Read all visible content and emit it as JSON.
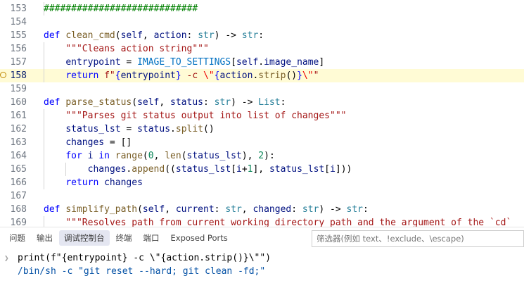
{
  "editor": {
    "lines": [
      {
        "num": "153",
        "tokens": [
          {
            "t": "############################",
            "c": "cmt"
          }
        ],
        "guides": 1
      },
      {
        "num": "154",
        "tokens": [],
        "guides": 0
      },
      {
        "num": "155",
        "tokens": [
          {
            "t": "def ",
            "c": "kw"
          },
          {
            "t": "clean_cmd",
            "c": "fn"
          },
          {
            "t": "(",
            "c": "def"
          },
          {
            "t": "self",
            "c": "var"
          },
          {
            "t": ", ",
            "c": "def"
          },
          {
            "t": "action",
            "c": "var"
          },
          {
            "t": ": ",
            "c": "def"
          },
          {
            "t": "str",
            "c": "ty"
          },
          {
            "t": ") -> ",
            "c": "def"
          },
          {
            "t": "str",
            "c": "ty"
          },
          {
            "t": ":",
            "c": "def"
          }
        ],
        "guides": 0
      },
      {
        "num": "156",
        "tokens": [
          {
            "t": "    \"\"\"Cleans action string\"\"\"",
            "c": "str"
          }
        ],
        "guides": 1
      },
      {
        "num": "157",
        "tokens": [
          {
            "t": "    ",
            "c": "def"
          },
          {
            "t": "entrypoint",
            "c": "var"
          },
          {
            "t": " = ",
            "c": "def"
          },
          {
            "t": "IMAGE_TO_SETTINGS",
            "c": "const"
          },
          {
            "t": "[",
            "c": "def"
          },
          {
            "t": "self",
            "c": "var"
          },
          {
            "t": ".",
            "c": "def"
          },
          {
            "t": "image_name",
            "c": "var"
          },
          {
            "t": "]",
            "c": "def"
          }
        ],
        "guides": 1
      },
      {
        "num": "158",
        "tokens": [
          {
            "t": "    ",
            "c": "def"
          },
          {
            "t": "return ",
            "c": "kw"
          },
          {
            "t": "f\"",
            "c": "str"
          },
          {
            "t": "{",
            "c": "kw"
          },
          {
            "t": "entrypoint",
            "c": "var"
          },
          {
            "t": "}",
            "c": "kw"
          },
          {
            "t": " -c ",
            "c": "str"
          },
          {
            "t": "\\\"",
            "c": "esc"
          },
          {
            "t": "{",
            "c": "kw"
          },
          {
            "t": "action",
            "c": "var"
          },
          {
            "t": ".",
            "c": "def"
          },
          {
            "t": "strip",
            "c": "fn"
          },
          {
            "t": "()",
            "c": "def"
          },
          {
            "t": "}",
            "c": "kw"
          },
          {
            "t": "\\\"",
            "c": "esc"
          },
          {
            "t": "\"",
            "c": "str"
          }
        ],
        "guides": 1,
        "current": true,
        "breakpoint": true
      },
      {
        "num": "159",
        "tokens": [],
        "guides": 0
      },
      {
        "num": "160",
        "tokens": [
          {
            "t": "def ",
            "c": "kw"
          },
          {
            "t": "parse_status",
            "c": "fn"
          },
          {
            "t": "(",
            "c": "def"
          },
          {
            "t": "self",
            "c": "var"
          },
          {
            "t": ", ",
            "c": "def"
          },
          {
            "t": "status",
            "c": "var"
          },
          {
            "t": ": ",
            "c": "def"
          },
          {
            "t": "str",
            "c": "ty"
          },
          {
            "t": ") -> ",
            "c": "def"
          },
          {
            "t": "List",
            "c": "ty"
          },
          {
            "t": ":",
            "c": "def"
          }
        ],
        "guides": 0
      },
      {
        "num": "161",
        "tokens": [
          {
            "t": "    \"\"\"Parses git status output into list of changes\"\"\"",
            "c": "str"
          }
        ],
        "guides": 1
      },
      {
        "num": "162",
        "tokens": [
          {
            "t": "    ",
            "c": "def"
          },
          {
            "t": "status_lst",
            "c": "var"
          },
          {
            "t": " = ",
            "c": "def"
          },
          {
            "t": "status",
            "c": "var"
          },
          {
            "t": ".",
            "c": "def"
          },
          {
            "t": "split",
            "c": "fn"
          },
          {
            "t": "()",
            "c": "def"
          }
        ],
        "guides": 1
      },
      {
        "num": "163",
        "tokens": [
          {
            "t": "    ",
            "c": "def"
          },
          {
            "t": "changes",
            "c": "var"
          },
          {
            "t": " = []",
            "c": "def"
          }
        ],
        "guides": 1
      },
      {
        "num": "164",
        "tokens": [
          {
            "t": "    ",
            "c": "def"
          },
          {
            "t": "for ",
            "c": "kw"
          },
          {
            "t": "i",
            "c": "var"
          },
          {
            "t": " in ",
            "c": "kw"
          },
          {
            "t": "range",
            "c": "fn"
          },
          {
            "t": "(",
            "c": "def"
          },
          {
            "t": "0",
            "c": "num"
          },
          {
            "t": ", ",
            "c": "def"
          },
          {
            "t": "len",
            "c": "fn"
          },
          {
            "t": "(",
            "c": "def"
          },
          {
            "t": "status_lst",
            "c": "var"
          },
          {
            "t": "), ",
            "c": "def"
          },
          {
            "t": "2",
            "c": "num"
          },
          {
            "t": "):",
            "c": "def"
          }
        ],
        "guides": 1
      },
      {
        "num": "165",
        "tokens": [
          {
            "t": "        ",
            "c": "def"
          },
          {
            "t": "changes",
            "c": "var"
          },
          {
            "t": ".",
            "c": "def"
          },
          {
            "t": "append",
            "c": "fn"
          },
          {
            "t": "((",
            "c": "def"
          },
          {
            "t": "status_lst",
            "c": "var"
          },
          {
            "t": "[",
            "c": "def"
          },
          {
            "t": "i",
            "c": "var"
          },
          {
            "t": "+",
            "c": "def"
          },
          {
            "t": "1",
            "c": "num"
          },
          {
            "t": "], ",
            "c": "def"
          },
          {
            "t": "status_lst",
            "c": "var"
          },
          {
            "t": "[",
            "c": "def"
          },
          {
            "t": "i",
            "c": "var"
          },
          {
            "t": "]))",
            "c": "def"
          }
        ],
        "guides": 2
      },
      {
        "num": "166",
        "tokens": [
          {
            "t": "    ",
            "c": "def"
          },
          {
            "t": "return ",
            "c": "kw"
          },
          {
            "t": "changes",
            "c": "var"
          }
        ],
        "guides": 1
      },
      {
        "num": "167",
        "tokens": [],
        "guides": 0
      },
      {
        "num": "168",
        "tokens": [
          {
            "t": "def ",
            "c": "kw"
          },
          {
            "t": "simplify_path",
            "c": "fn"
          },
          {
            "t": "(",
            "c": "def"
          },
          {
            "t": "self",
            "c": "var"
          },
          {
            "t": ", ",
            "c": "def"
          },
          {
            "t": "current",
            "c": "var"
          },
          {
            "t": ": ",
            "c": "def"
          },
          {
            "t": "str",
            "c": "ty"
          },
          {
            "t": ", ",
            "c": "def"
          },
          {
            "t": "changed",
            "c": "var"
          },
          {
            "t": ": ",
            "c": "def"
          },
          {
            "t": "str",
            "c": "ty"
          },
          {
            "t": ") -> ",
            "c": "def"
          },
          {
            "t": "str",
            "c": "ty"
          },
          {
            "t": ":",
            "c": "def"
          }
        ],
        "guides": 0
      },
      {
        "num": "169",
        "tokens": [
          {
            "t": "    \"\"\"Resolves path from current working directory path and the argument of the `cd`",
            "c": "str"
          }
        ],
        "guides": 1
      }
    ]
  },
  "panel": {
    "tabs": [
      {
        "label": "问题",
        "name": "tab-problems"
      },
      {
        "label": "输出",
        "name": "tab-output"
      },
      {
        "label": "调试控制台",
        "name": "tab-debug-console",
        "active": true
      },
      {
        "label": "终端",
        "name": "tab-terminal"
      },
      {
        "label": "端口",
        "name": "tab-ports"
      },
      {
        "label": "Exposed Ports",
        "name": "tab-exposed-ports"
      }
    ],
    "filter_placeholder": "筛选器(例如 text、!exclude、\\escape)"
  },
  "console": {
    "lines": [
      {
        "text": "print(f\"{entrypoint} -c \\\"{action.strip()}\\\"\")",
        "kind": "input",
        "chevron": "❯"
      },
      {
        "text": "/bin/sh -c \"git reset --hard; git clean -fd;\"",
        "kind": "output"
      }
    ]
  }
}
